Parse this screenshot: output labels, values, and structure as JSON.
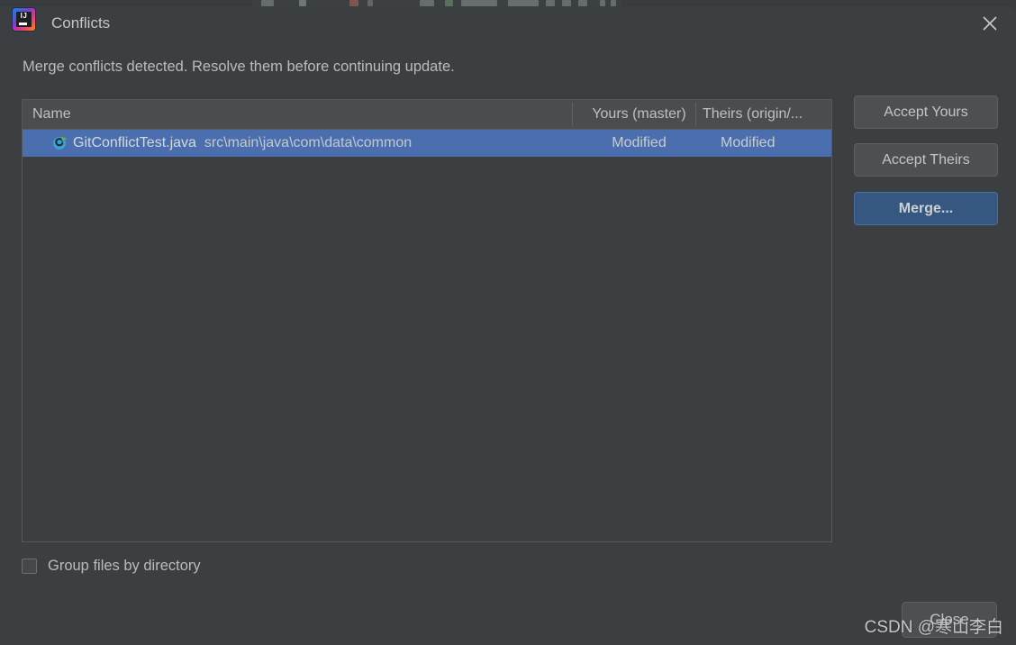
{
  "window": {
    "title": "Conflicts",
    "app_icon": "intellij-idea-logo",
    "app_icon_text": "IJ",
    "close_icon": "close-icon"
  },
  "message": "Merge conflicts detected. Resolve them before continuing update.",
  "table": {
    "columns": [
      "Name",
      "Yours (master)",
      "Theirs (origin/..."
    ],
    "rows": [
      {
        "icon": "java-class-runnable-icon",
        "icon_letter": "C",
        "file": "GitConflictTest.java",
        "path": "src\\main\\java\\com\\data\\common",
        "yours": "Modified",
        "theirs": "Modified",
        "selected": true
      }
    ]
  },
  "actions": {
    "accept_yours": "Accept Yours",
    "accept_theirs": "Accept Theirs",
    "merge": "Merge...",
    "close": "Close"
  },
  "options": {
    "group_files_label": "Group files by directory",
    "group_files_checked": false
  },
  "watermark": "CSDN @寒山李白",
  "colors": {
    "dialog_bg": "#3c3f41",
    "header_bg": "#4a4d4f",
    "selection_blue": "#4b6eaf",
    "default_button_blue": "#365880",
    "button_bg": "#4c5052",
    "text": "#b9bcbf"
  }
}
